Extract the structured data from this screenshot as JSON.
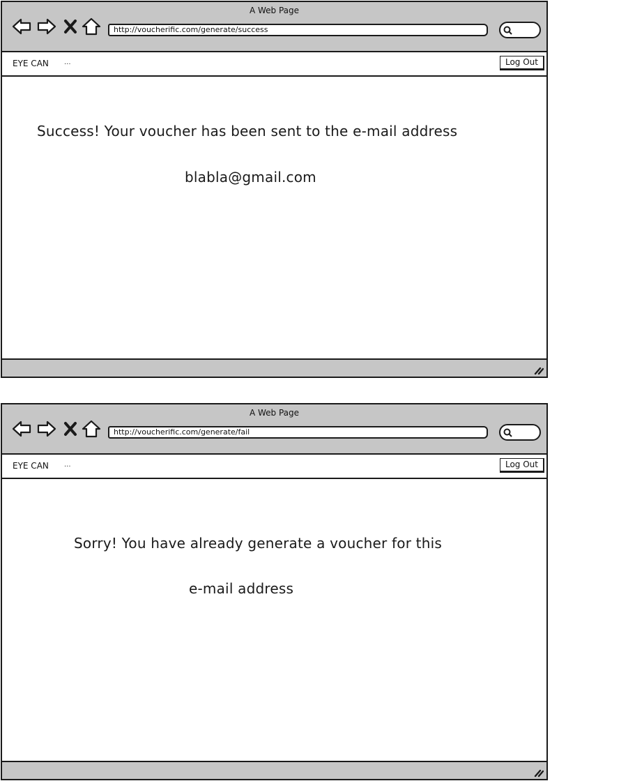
{
  "windows": [
    {
      "title": "A Web Page",
      "url": "http://voucherific.com/generate/success",
      "brand": "EYE CAN",
      "ellipsis": "...",
      "logout_label": "Log Out",
      "message_line1": "Success! Your voucher has been sent to the e-mail address",
      "message_line2": "blabla@gmail.com"
    },
    {
      "title": "A Web Page",
      "url": "http://voucherific.com/generate/fail",
      "brand": "EYE CAN",
      "ellipsis": "...",
      "logout_label": "Log Out",
      "message_line1": "Sorry! You have already generate a voucher for this",
      "message_line2": "e-mail address"
    }
  ],
  "icons": {
    "back": "back-arrow-icon",
    "forward": "forward-arrow-icon",
    "stop": "close-icon",
    "home": "home-icon",
    "search": "search-icon",
    "resize": "resize-grip-icon"
  },
  "colors": {
    "chrome": "#c6c6c6",
    "outline": "#1a1a1a",
    "page": "#ffffff"
  }
}
